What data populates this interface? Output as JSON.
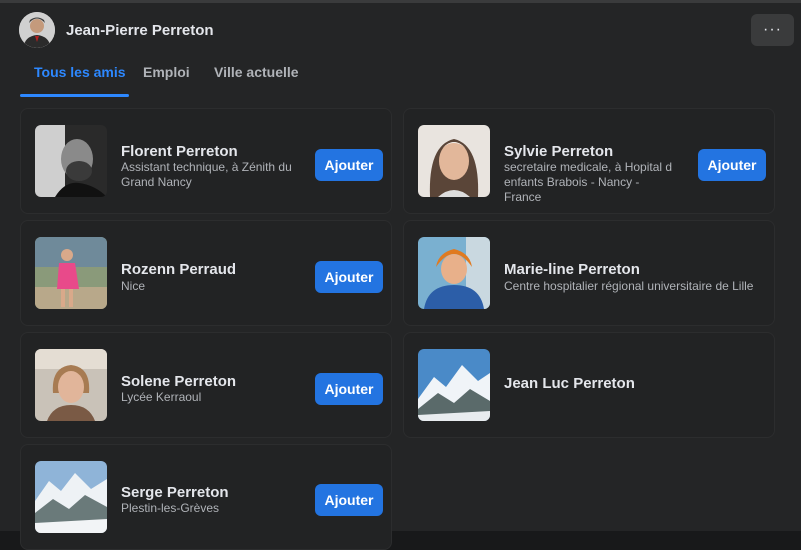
{
  "header": {
    "profile_name": "Jean-Pierre Perreton",
    "more_label": "···"
  },
  "tabs": [
    {
      "label": "Tous les amis",
      "active": true
    },
    {
      "label": "Emploi",
      "active": false
    },
    {
      "label": "Ville actuelle",
      "active": false
    }
  ],
  "friends": [
    {
      "name": "Florent Perreton",
      "subtitle": "Assistant technique, à Zénith du Grand Nancy",
      "button": "Ajouter"
    },
    {
      "name": "Sylvie Perreton",
      "subtitle": "secretaire medicale, à Hopital d enfants Brabois - Nancy - France",
      "button": "Ajouter"
    },
    {
      "name": "Rozenn Perraud",
      "subtitle": "Nice",
      "button": "Ajouter"
    },
    {
      "name": "Marie-line Perreton",
      "subtitle": "Centre hospitalier régional universitaire de Lille",
      "button": ""
    },
    {
      "name": "Solene Perreton",
      "subtitle": "Lycée Kerraoul",
      "button": "Ajouter"
    },
    {
      "name": "Jean Luc Perreton",
      "subtitle": "",
      "button": ""
    },
    {
      "name": "Serge Perreton",
      "subtitle": "Plestin-les-Grèves",
      "button": "Ajouter"
    }
  ],
  "colors": {
    "background": "#18191a",
    "surface": "#242526",
    "accent": "#2d88ff",
    "button": "#2374e1"
  }
}
